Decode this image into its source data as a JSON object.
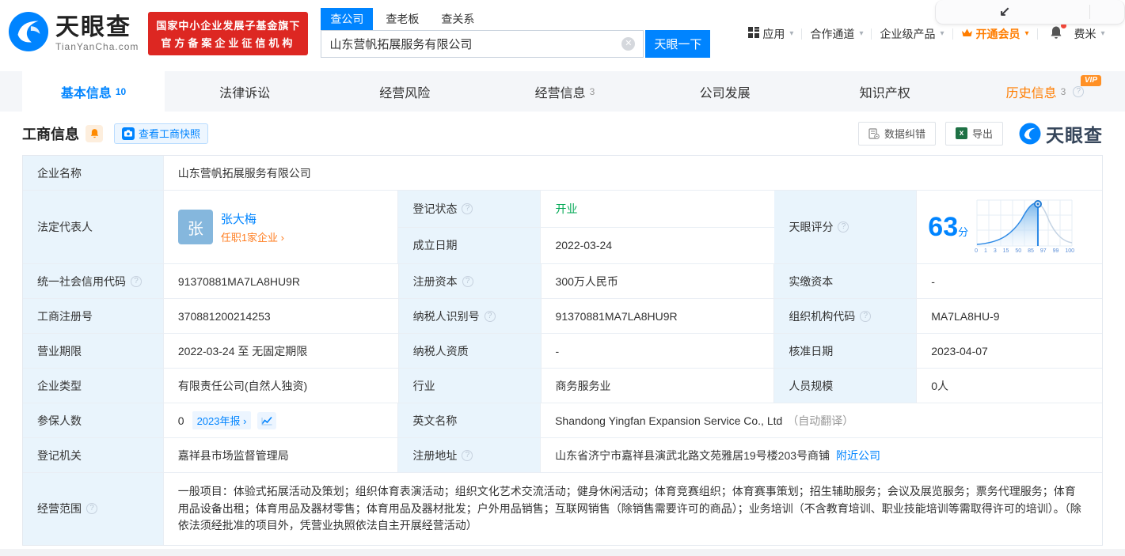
{
  "header": {
    "logo": {
      "brand": "天眼查",
      "domain": "TianYanCha.com"
    },
    "badge": {
      "line1": "国家中小企业发展子基金旗下",
      "line2": "官方备案企业征信机构"
    },
    "search": {
      "tabs": [
        {
          "label": "查公司"
        },
        {
          "label": "查老板"
        },
        {
          "label": "查关系"
        }
      ],
      "value": "山东营帆拓展服务有限公司",
      "button_label": "天眼一下"
    },
    "nav": {
      "apps": "应用",
      "partner": "合作通道",
      "enterprise": "企业级产品",
      "vip": "开通会员",
      "user": "费米"
    }
  },
  "tabs": [
    {
      "label": "基本信息",
      "count": "10"
    },
    {
      "label": "法律诉讼"
    },
    {
      "label": "经营风险"
    },
    {
      "label": "经营信息",
      "count": "3"
    },
    {
      "label": "公司发展"
    },
    {
      "label": "知识产权"
    },
    {
      "label": "历史信息",
      "count": "3",
      "vip_badge": "VIP"
    }
  ],
  "section": {
    "title": "工商信息",
    "snapshot_button": "查看工商快照",
    "correction_button": "数据纠错",
    "export_button": "导出",
    "watermark": "天眼查"
  },
  "info": {
    "company_name": {
      "label": "企业名称",
      "value": "山东营帆拓展服务有限公司"
    },
    "legal_rep": {
      "label": "法定代表人",
      "avatar": "张",
      "name": "张大梅",
      "positions_link": "任职1家企业 ›"
    },
    "reg_status": {
      "label": "登记状态",
      "value": "开业"
    },
    "establish_date": {
      "label": "成立日期",
      "value": "2022-03-24"
    },
    "score": {
      "label": "天眼评分",
      "value": "63",
      "unit": "分",
      "axis_labels": [
        "0",
        "1",
        "3",
        "15",
        "50",
        "85",
        "97",
        "99",
        "100"
      ]
    },
    "credit_code": {
      "label": "统一社会信用代码",
      "value": "91370881MA7LA8HU9R"
    },
    "reg_capital": {
      "label": "注册资本",
      "value": "300万人民币"
    },
    "paid_capital": {
      "label": "实缴资本",
      "value": "-"
    },
    "reg_number": {
      "label": "工商注册号",
      "value": "370881200214253"
    },
    "taxpayer_id": {
      "label": "纳税人识别号",
      "value": "91370881MA7LA8HU9R"
    },
    "org_code": {
      "label": "组织机构代码",
      "value": "MA7LA8HU-9"
    },
    "business_term": {
      "label": "营业期限",
      "value": "2022-03-24 至 无固定期限"
    },
    "taxpayer_quality": {
      "label": "纳税人资质",
      "value": "-"
    },
    "approval_date": {
      "label": "核准日期",
      "value": "2023-04-07"
    },
    "company_type": {
      "label": "企业类型",
      "value": "有限责任公司(自然人独资)"
    },
    "industry": {
      "label": "行业",
      "value": "商务服务业"
    },
    "staff_size": {
      "label": "人员规模",
      "value": "0人"
    },
    "insured_count": {
      "label": "参保人数",
      "value": "0",
      "report_tag": "2023年报 ›"
    },
    "english_name": {
      "label": "英文名称",
      "value": "Shandong Yingfan Expansion Service Co., Ltd",
      "note": "（自动翻译）"
    },
    "reg_authority": {
      "label": "登记机关",
      "value": "嘉祥县市场监督管理局"
    },
    "reg_address": {
      "label": "注册地址",
      "value": "山东省济宁市嘉祥县演武北路文苑雅居19号楼203号商铺",
      "nearby_link": "附近公司"
    },
    "business_scope": {
      "label": "经营范围",
      "value": "一般项目：体验式拓展活动及策划；组织体育表演活动；组织文化艺术交流活动；健身休闲活动；体育竞赛组织；体育赛事策划；招生辅助服务；会议及展览服务；票务代理服务；体育用品设备出租；体育用品及器材零售；体育用品及器材批发；户外用品销售；互联网销售（除销售需要许可的商品）；业务培训（不含教育培训、职业技能培训等需取得许可的培训）。（除依法须经批准的项目外，凭营业执照依法自主开展经营活动）"
    }
  },
  "colors": {
    "brand_blue": "#0084ff",
    "status_green": "#00a854",
    "accent_orange": "#ff7d20",
    "label_bg": "#e9f4fc"
  }
}
